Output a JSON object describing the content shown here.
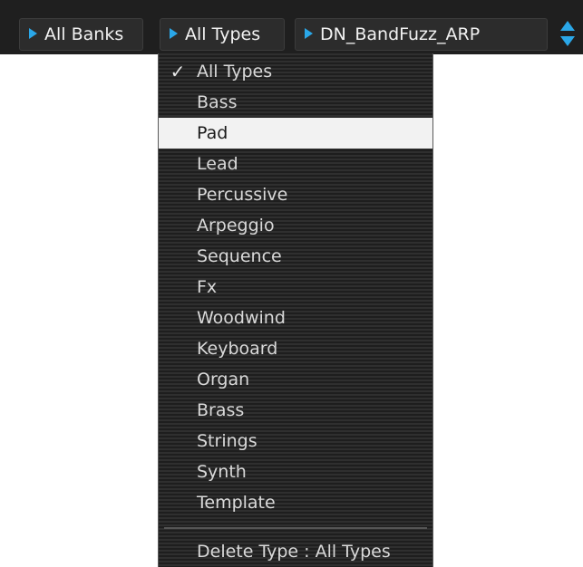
{
  "toolbar": {
    "bank_label": "All Banks",
    "type_label": "All Types",
    "preset_label": "DN_BandFuzz_ARP"
  },
  "menu": {
    "checked_index": 0,
    "selected_index": 2,
    "items": [
      "All Types",
      "Bass",
      "Pad",
      "Lead",
      "Percussive",
      "Arpeggio",
      "Sequence",
      "Fx",
      "Woodwind",
      "Keyboard",
      "Organ",
      "Brass",
      "Strings",
      "Synth",
      "Template"
    ],
    "delete_label": "Delete Type : All Types"
  },
  "colors": {
    "accent": "#2aa7e8",
    "menu_background": "#262626",
    "selected_background": "#f2f2f2",
    "toolbar_background": "#1f1f1f"
  }
}
